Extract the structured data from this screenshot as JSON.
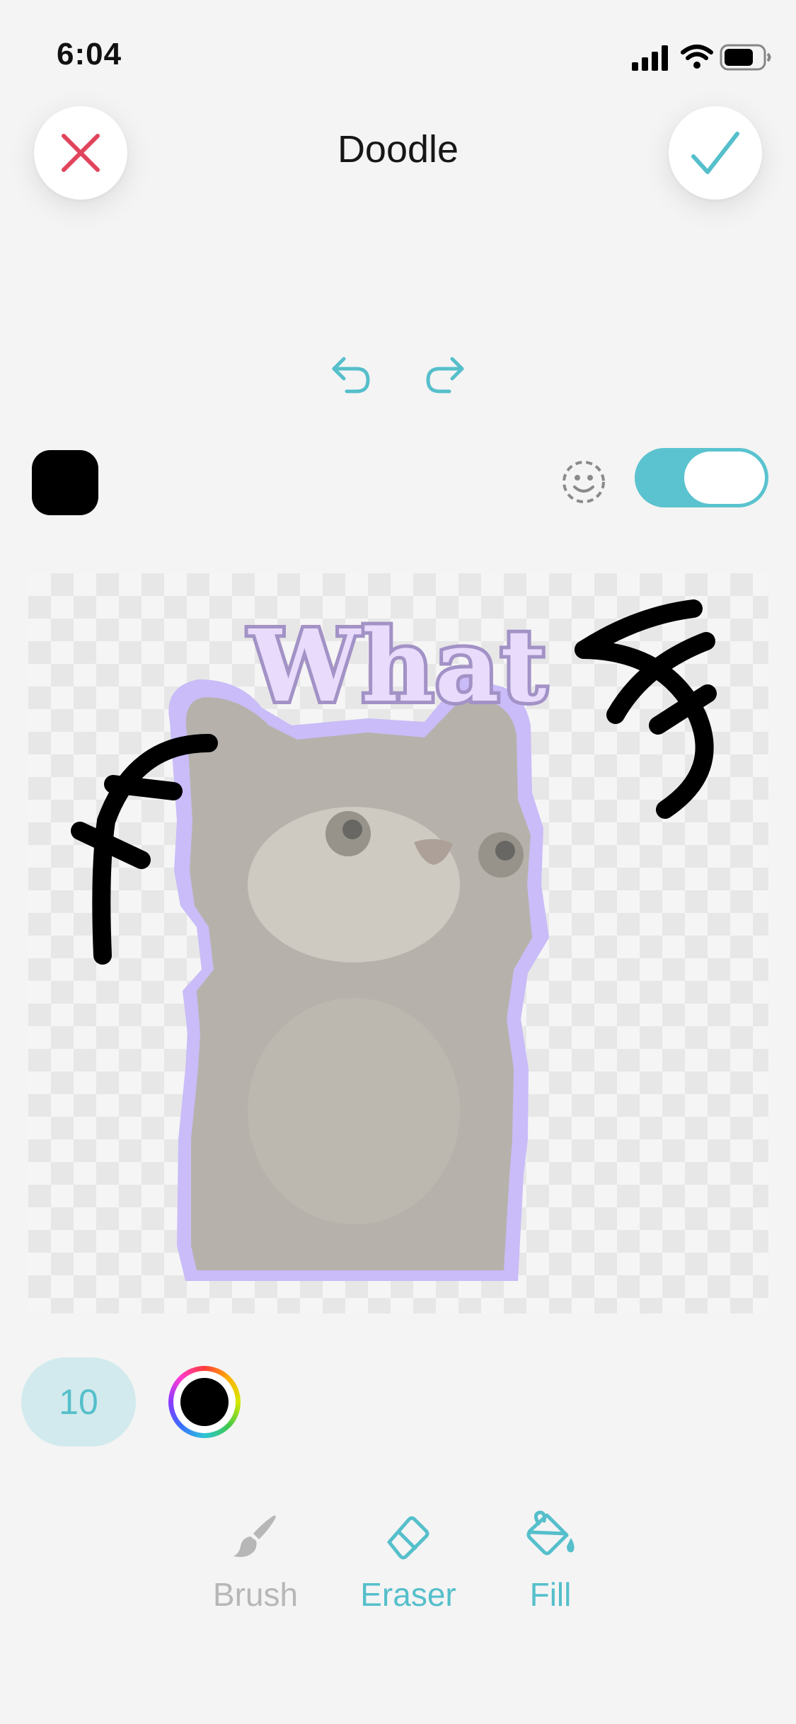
{
  "status_bar": {
    "time": "6:04",
    "icons": [
      "cellular-signal-icon",
      "wifi-icon",
      "battery-icon"
    ]
  },
  "header": {
    "title": "Doodle",
    "close_icon": "close-icon",
    "confirm_icon": "checkmark-icon"
  },
  "history": {
    "undo_icon": "undo-icon",
    "redo_icon": "redo-icon"
  },
  "options": {
    "selected_color": "#000000",
    "sticker_face_icon": "sticker-face-icon",
    "toggle_on": true,
    "toggle_color": "#5ac3cf"
  },
  "canvas": {
    "sticker_text": "What",
    "sticker_outline_color": "#b4a2f5"
  },
  "brush": {
    "size": "10",
    "current_color": "#000000"
  },
  "tools": [
    {
      "label": "Brush",
      "icon": "brush-icon",
      "active": false
    },
    {
      "label": "Eraser",
      "icon": "eraser-icon",
      "active": true
    },
    {
      "label": "Fill",
      "icon": "fill-bucket-icon",
      "active": true
    }
  ],
  "colors": {
    "accent": "#55bfcb",
    "close": "#e0455b",
    "inactive": "#b7b7b7",
    "background": "#f4f4f4"
  }
}
